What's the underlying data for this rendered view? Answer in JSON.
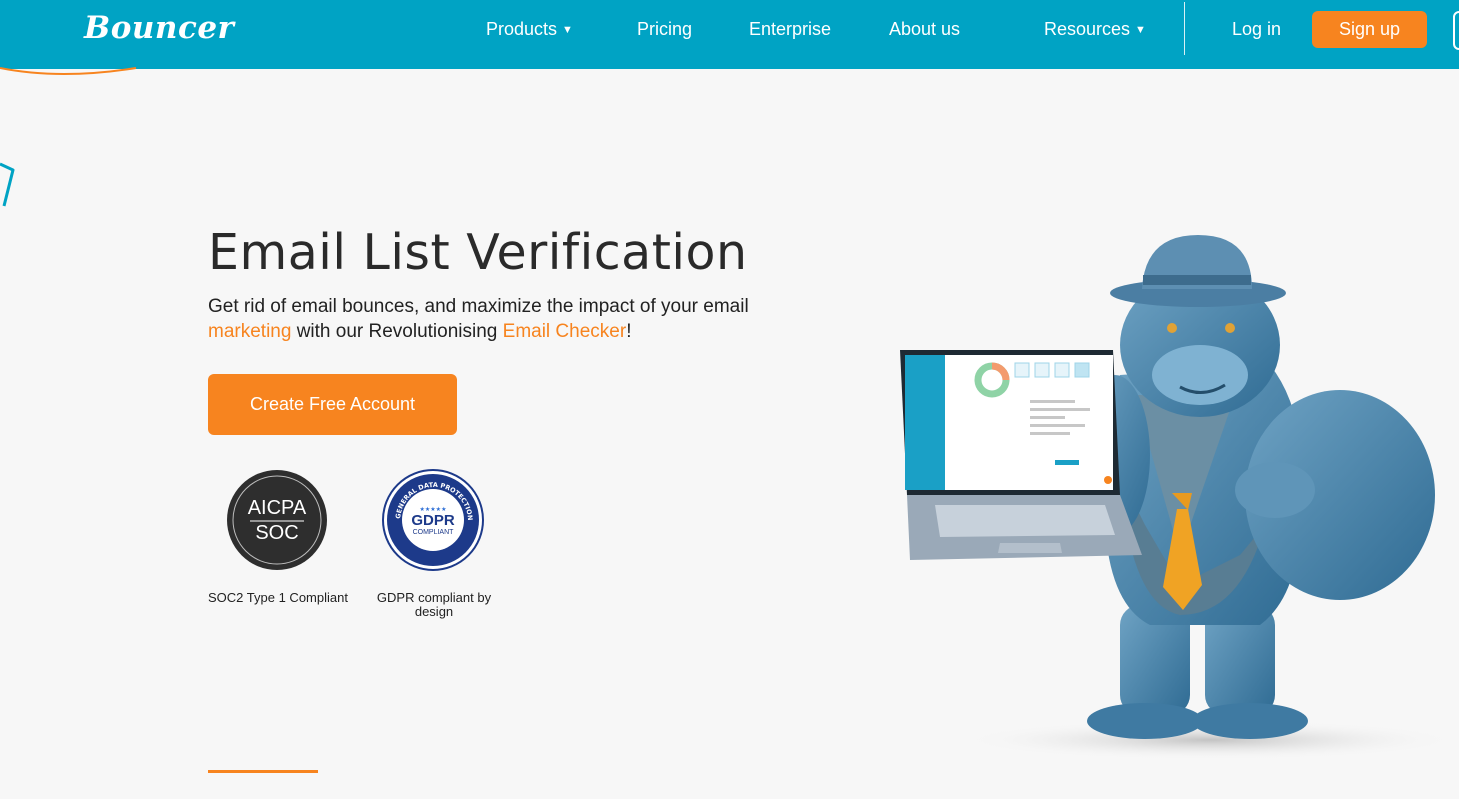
{
  "header": {
    "logo": "Bouncer",
    "nav": [
      {
        "label": "Products",
        "dropdown": true
      },
      {
        "label": "Pricing",
        "dropdown": false
      },
      {
        "label": "Enterprise",
        "dropdown": false
      },
      {
        "label": "About us",
        "dropdown": false
      },
      {
        "label": "Resources",
        "dropdown": true
      }
    ],
    "login": "Log in",
    "signup": "Sign up"
  },
  "hero": {
    "title": "Email List Verification",
    "subtitle_part1": "Get rid of email bounces, and maximize the impact of your email ",
    "subtitle_highlight1": "marketing",
    "subtitle_part2": " with our Revolutionising ",
    "subtitle_highlight2": "Email Checker",
    "subtitle_part3": "!",
    "cta": "Create Free Account"
  },
  "badges": [
    {
      "seal_top": "AICPA",
      "seal_bottom": "SOC",
      "caption": "SOC2 Type 1 Compliant"
    },
    {
      "seal_top": "GDPR",
      "seal_bottom": "COMPLIANT",
      "ring_text": "GENERAL DATA PROTECTION REGULATION",
      "caption": "GDPR compliant by design"
    }
  ],
  "colors": {
    "header": "#00a3c4",
    "accent": "#f7841f",
    "background": "#f7f7f7"
  },
  "icons": {
    "chevron": "chevron-down-icon"
  }
}
